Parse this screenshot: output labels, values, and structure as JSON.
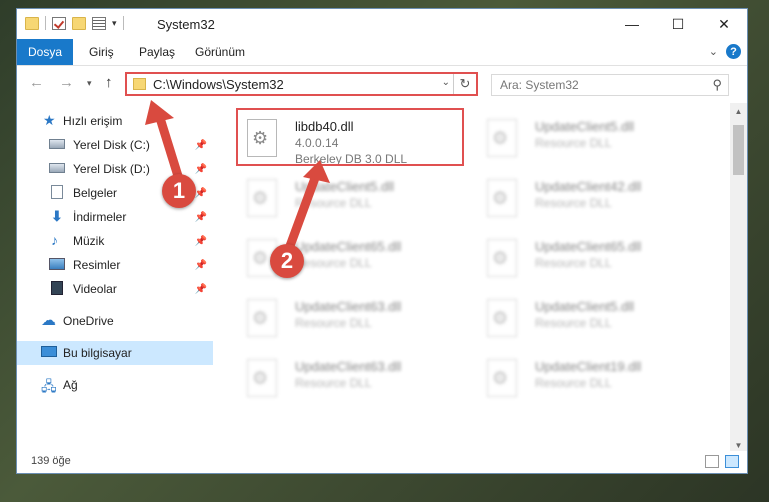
{
  "window": {
    "title": "System32"
  },
  "ribbon": {
    "tabs": [
      "Dosya",
      "Giriş",
      "Paylaş",
      "Görünüm"
    ]
  },
  "address": {
    "path": "C:\\Windows\\System32"
  },
  "search": {
    "placeholder": "Ara: System32"
  },
  "nav": {
    "items": [
      {
        "label": "Hızlı erişim",
        "icon": "star-icon"
      },
      {
        "label": "Yerel Disk (C:)",
        "icon": "disk-icon",
        "pinned": true
      },
      {
        "label": "Yerel Disk (D:)",
        "icon": "disk-icon",
        "pinned": true
      },
      {
        "label": "Belgeler",
        "icon": "document-icon",
        "pinned": true
      },
      {
        "label": "İndirmeler",
        "icon": "download-icon",
        "pinned": true
      },
      {
        "label": "Müzik",
        "icon": "music-icon",
        "pinned": true
      },
      {
        "label": "Resimler",
        "icon": "pictures-icon",
        "pinned": true
      },
      {
        "label": "Videolar",
        "icon": "video-icon",
        "pinned": true
      },
      {
        "label": "OneDrive",
        "icon": "cloud-icon"
      },
      {
        "label": "Bu bilgisayar",
        "icon": "computer-icon",
        "selected": true
      },
      {
        "label": "Ağ",
        "icon": "network-icon"
      }
    ]
  },
  "files": [
    {
      "name": "libdb40.dll",
      "version": "4.0.0.14",
      "desc": "Berkeley DB 3.0 DLL"
    },
    {
      "name": "UpdateClient5.dll",
      "desc": "Resource DLL"
    },
    {
      "name": "UpdateClient5.dll",
      "desc": "Resource DLL"
    },
    {
      "name": "UpdateClient42.dll",
      "desc": "Resource DLL"
    },
    {
      "name": "UpdateClient65.dll",
      "desc": "Resource DLL"
    },
    {
      "name": "UpdateClient65.dll",
      "desc": "Resource DLL"
    },
    {
      "name": "UpdateClient63.dll",
      "desc": "Resource DLL"
    },
    {
      "name": "UpdateClient5.dll",
      "desc": "Resource DLL"
    },
    {
      "name": "UpdateClient63.dll",
      "desc": "Resource DLL"
    },
    {
      "name": "UpdateClient19.dll",
      "desc": "Resource DLL"
    }
  ],
  "status": {
    "count": "139 öğe"
  },
  "markers": [
    "1",
    "2"
  ],
  "colors": {
    "accent": "#1979ca",
    "annotation": "#d94a3f",
    "selection": "#cce8ff"
  }
}
